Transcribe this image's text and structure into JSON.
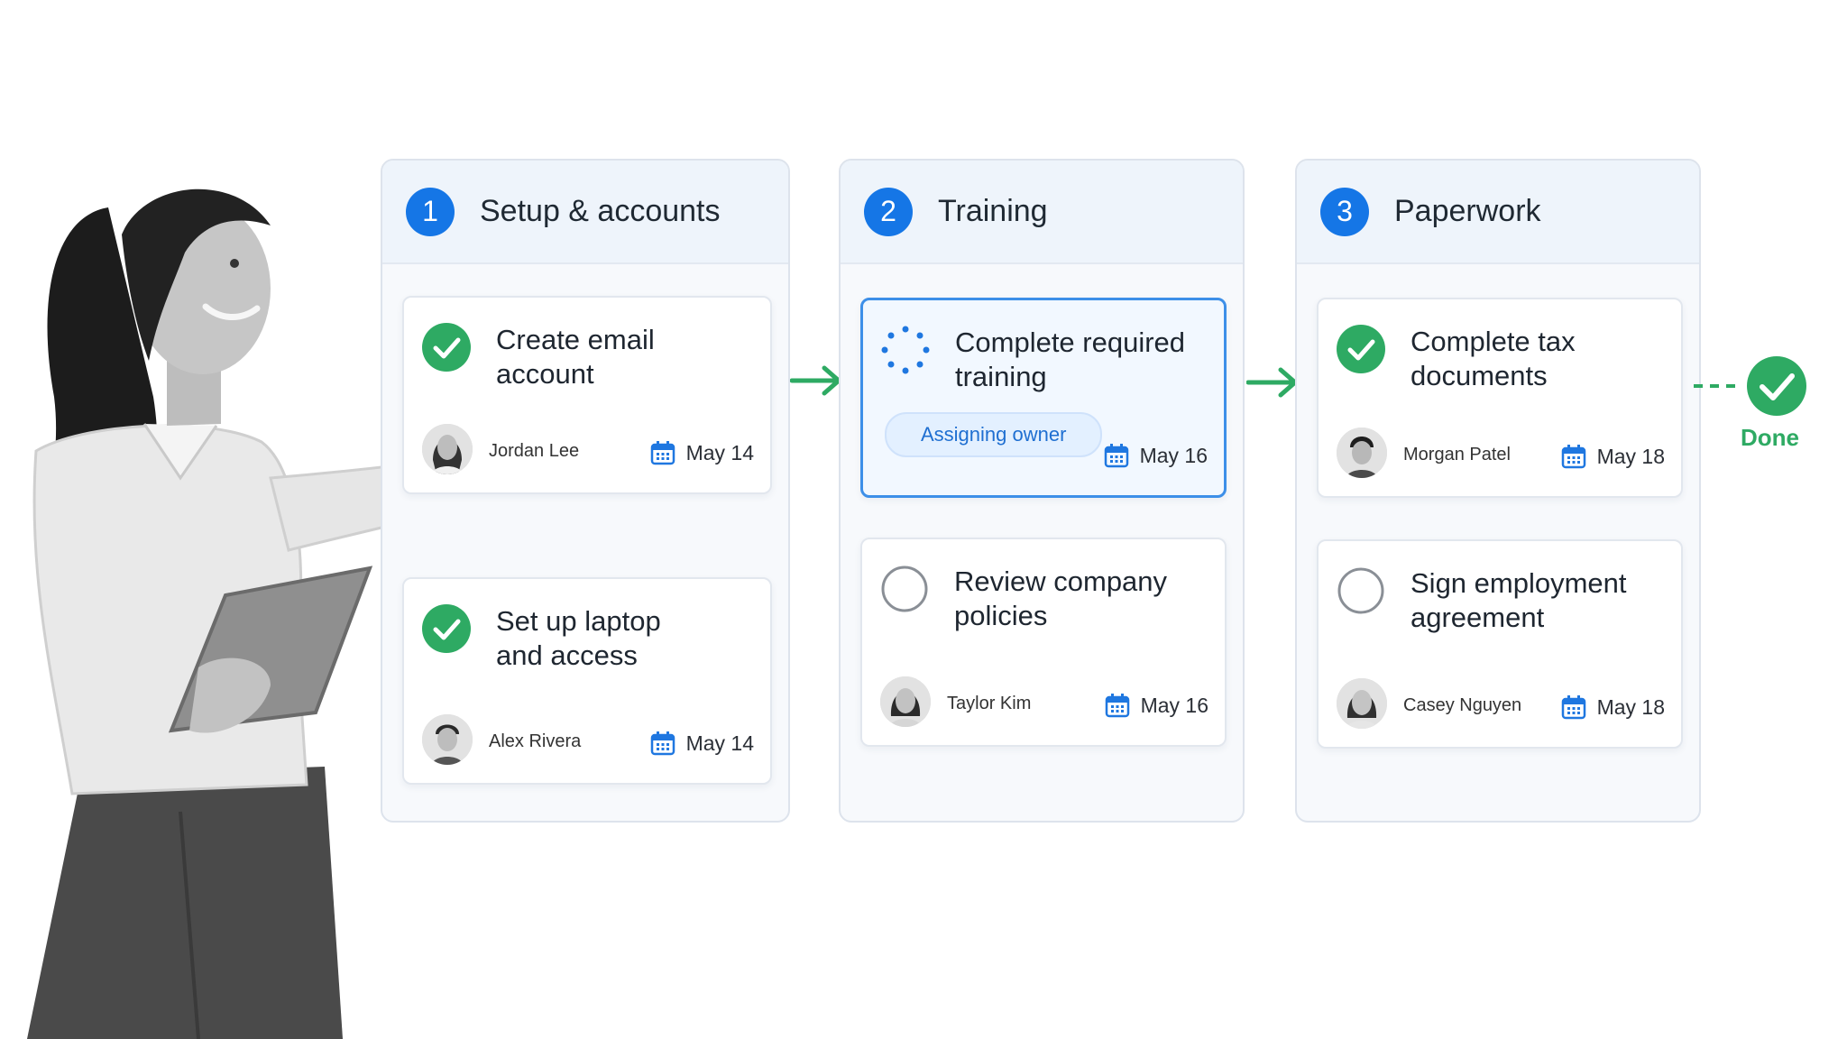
{
  "colors": {
    "accent_blue": "#1576e6",
    "done_green": "#2eaa63",
    "active_border": "#3d8fe8",
    "column_bg": "#f7f9fc"
  },
  "columns": [
    {
      "number": "1",
      "title": "Setup & accounts",
      "cards": [
        {
          "title": "Create email\naccount",
          "status": "done",
          "assignee": "Jordan Lee",
          "due": "May 14"
        },
        {
          "title": "Set up laptop\nand access",
          "status": "done",
          "assignee": "Alex Rivera",
          "due": "May 14"
        }
      ]
    },
    {
      "number": "2",
      "title": "Training",
      "cards": [
        {
          "title": "Complete required\ntraining",
          "status": "in-progress",
          "pill": "Assigning owner",
          "due": "May 16"
        },
        {
          "title": "Review company\npolicies",
          "status": "todo",
          "assignee": "Taylor Kim",
          "due": "May 16"
        }
      ]
    },
    {
      "number": "3",
      "title": "Paperwork",
      "cards": [
        {
          "title": "Complete tax\ndocuments",
          "status": "done",
          "assignee": "Morgan Patel",
          "due": "May 18"
        },
        {
          "title": "Sign employment\nagreement",
          "status": "todo",
          "assignee": "Casey Nguyen",
          "due": "May 18"
        }
      ]
    }
  ],
  "done": {
    "label": "Done"
  },
  "icons": {
    "done": "check-circle-icon",
    "todo": "empty-circle-icon",
    "in_progress": "spinner-icon",
    "due": "calendar-icon",
    "connector": "arrow-right-icon"
  }
}
